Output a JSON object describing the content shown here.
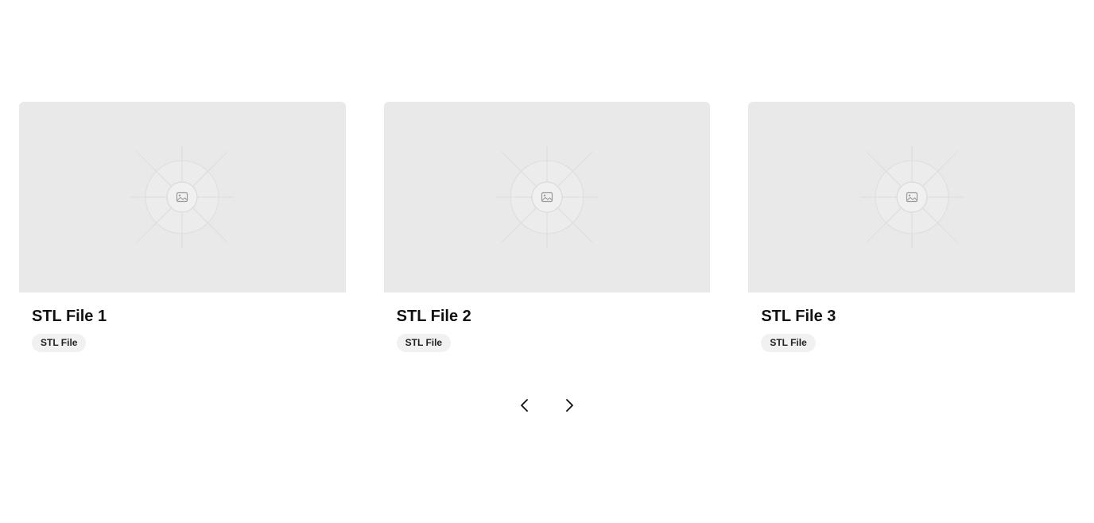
{
  "cards": [
    {
      "title": "STL File 1",
      "badge": "STL File",
      "image_icon": "image-placeholder-icon"
    },
    {
      "title": "STL File 2",
      "badge": "STL File",
      "image_icon": "image-placeholder-icon"
    },
    {
      "title": "STL File 3",
      "badge": "STL File",
      "image_icon": "image-placeholder-icon"
    }
  ],
  "pager": {
    "prev_icon": "chevron-left-icon",
    "next_icon": "chevron-right-icon"
  },
  "colors": {
    "placeholder_bg": "#e9e9e9",
    "badge_bg": "#f1f1f1",
    "text": "#111111"
  }
}
